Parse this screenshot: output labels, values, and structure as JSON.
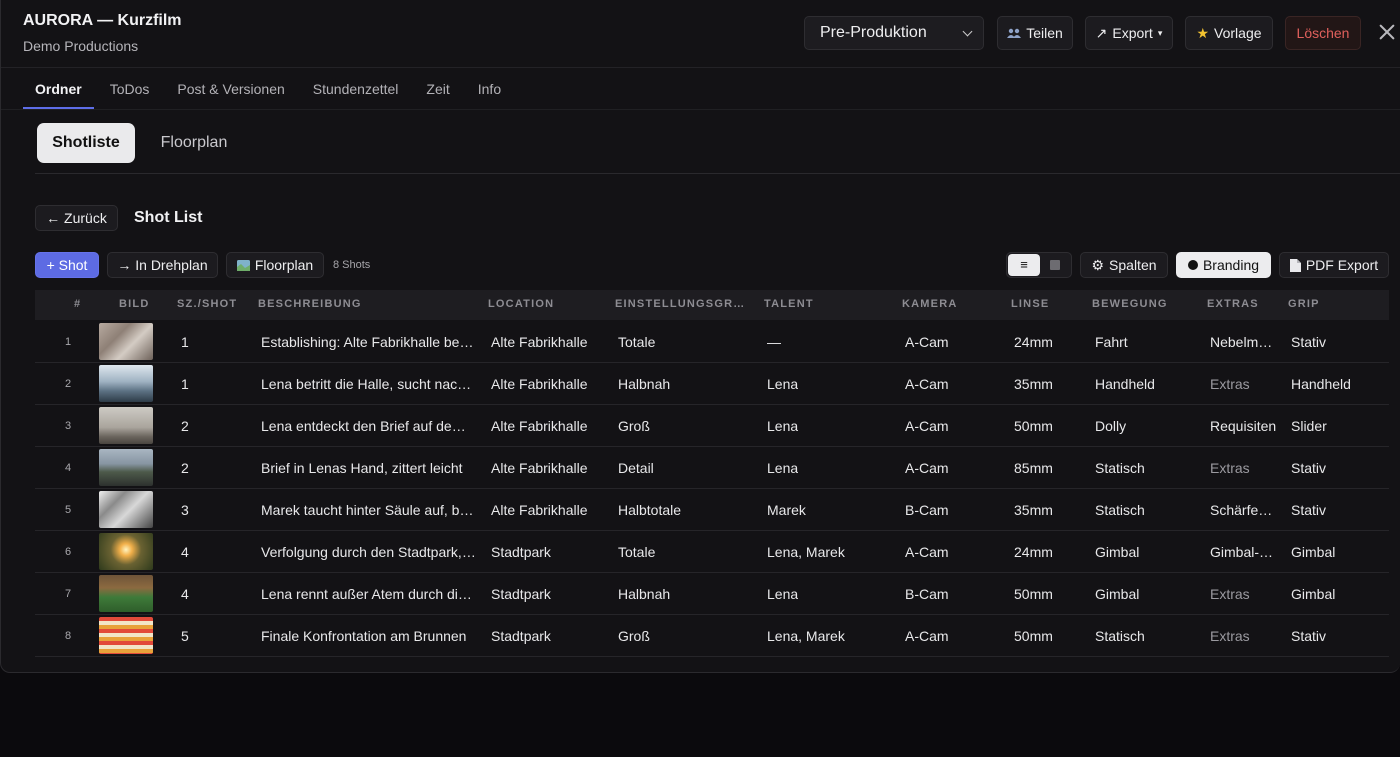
{
  "header": {
    "title": "AURORA — Kurzfilm",
    "subtitle": "Demo Productions",
    "phase_select": "Pre-Produktion",
    "share_label": "Teilen",
    "export_label": "Export",
    "template_label": "Vorlage",
    "delete_label": "Löschen",
    "icons": {
      "share": "people-icon",
      "export": "arrow-up-right-icon",
      "template": "star-icon",
      "close": "close-icon"
    }
  },
  "tabs": [
    "Ordner",
    "ToDos",
    "Post & Versionen",
    "Stundenzettel",
    "Zeit",
    "Info"
  ],
  "active_tab": "Ordner",
  "subtabs": [
    "Shotliste",
    "Floorplan"
  ],
  "active_subtab": "Shotliste",
  "shotlist": {
    "back_label": "← Zurück",
    "title": "Shot List",
    "add_shot_label": "+ Shot",
    "to_schedule_label": "→ In Drehplan",
    "floorplan_label": "Floorplan",
    "shots_count": "8 Shots",
    "columns_label": "Spalten",
    "branding_label": "Branding",
    "pdf_export_label": "PDF Export",
    "view_list_glyph": "≡"
  },
  "colors": {
    "accent": "#5d6be3",
    "danger": "#e0605c",
    "background": "#131215"
  },
  "table": {
    "headers": [
      "#",
      "BILD",
      "SZ./SHOT",
      "BESCHREIBUNG",
      "LOCATION",
      "EINSTELLUNGSGRÖSSE",
      "TALENT",
      "KAMERA",
      "LINSE",
      "BEWEGUNG",
      "EXTRAS",
      "GRIP"
    ],
    "rows": [
      {
        "n": "1",
        "scene": "1",
        "desc": "Establishing: Alte Fabrikhalle bei Nacht",
        "location": "Alte Fabrikhalle",
        "size": "Totale",
        "talent": "—",
        "camera": "A-Cam",
        "lens": "24mm",
        "move": "Fahrt",
        "extras": "Nebelmaschine",
        "grip": "Stativ",
        "thumb": "cat"
      },
      {
        "n": "2",
        "scene": "1",
        "desc": "Lena betritt die Halle, sucht nach dem Brief",
        "location": "Alte Fabrikhalle",
        "size": "Halbnah",
        "talent": "Lena",
        "camera": "A-Cam",
        "lens": "35mm",
        "move": "Handheld",
        "extras": "Extras",
        "grip": "Handheld",
        "thumb": "mist"
      },
      {
        "n": "3",
        "scene": "2",
        "desc": "Lena entdeckt den Brief auf dem Tisch",
        "location": "Alte Fabrikhalle",
        "size": "Groß",
        "talent": "Lena",
        "camera": "A-Cam",
        "lens": "50mm",
        "move": "Dolly",
        "extras": "Requisiten",
        "grip": "Slider",
        "thumb": "fog"
      },
      {
        "n": "4",
        "scene": "2",
        "desc": "Brief in Lenas Hand, zittert leicht",
        "location": "Alte Fabrikhalle",
        "size": "Detail",
        "talent": "Lena",
        "camera": "A-Cam",
        "lens": "85mm",
        "move": "Statisch",
        "extras": "Extras",
        "grip": "Stativ",
        "thumb": "road"
      },
      {
        "n": "5",
        "scene": "3",
        "desc": "Marek taucht hinter Säule auf, beobachtet",
        "location": "Alte Fabrikhalle",
        "size": "Halbtotale",
        "talent": "Marek",
        "camera": "B-Cam",
        "lens": "35mm",
        "move": "Statisch",
        "extras": "Schärfezieher",
        "grip": "Stativ",
        "thumb": "bw"
      },
      {
        "n": "6",
        "scene": "4",
        "desc": "Verfolgung durch den Stadtpark, Abendlicht",
        "location": "Stadtpark",
        "size": "Totale",
        "talent": "Lena, Marek",
        "camera": "A-Cam",
        "lens": "24mm",
        "move": "Gimbal",
        "extras": "Gimbal-Operator",
        "grip": "Gimbal",
        "thumb": "sunset"
      },
      {
        "n": "7",
        "scene": "4",
        "desc": "Lena rennt außer Atem durch die Wiese",
        "location": "Stadtpark",
        "size": "Halbnah",
        "talent": "Lena",
        "camera": "B-Cam",
        "lens": "50mm",
        "move": "Gimbal",
        "extras": "Extras",
        "grip": "Gimbal",
        "thumb": "meadow"
      },
      {
        "n": "8",
        "scene": "5",
        "desc": "Finale Konfrontation am Brunnen",
        "location": "Stadtpark",
        "size": "Groß",
        "talent": "Lena, Marek",
        "camera": "A-Cam",
        "lens": "50mm",
        "move": "Statisch",
        "extras": "Extras",
        "grip": "Stativ",
        "thumb": "stripes"
      }
    ]
  }
}
